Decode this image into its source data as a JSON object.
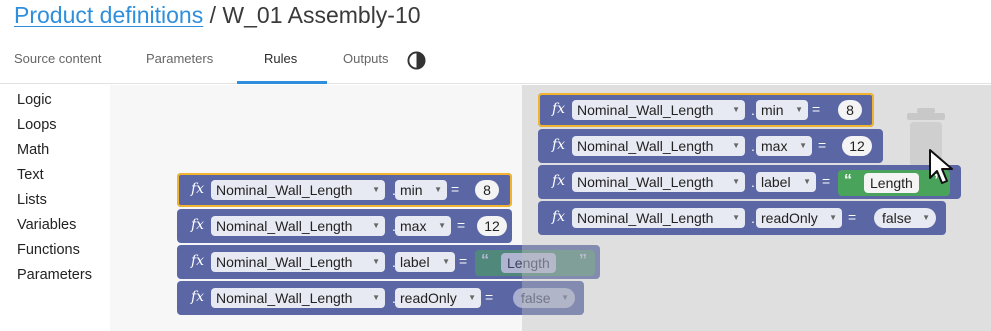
{
  "breadcrumb": {
    "link": "Product definitions",
    "separator": " / ",
    "current": "W_01 Assembly-10"
  },
  "tabs": [
    {
      "label": "Source content",
      "active": false
    },
    {
      "label": "Parameters",
      "active": false
    },
    {
      "label": "Rules",
      "active": true
    },
    {
      "label": "Outputs",
      "active": false
    }
  ],
  "icons": {
    "theme_toggle": "contrast-icon",
    "trash": "trash-can-icon",
    "cursor": "mouse-pointer-icon"
  },
  "colors": {
    "accent": "#2f8fdc",
    "block": "#5b67a5",
    "selected_outline": "#f2b42f",
    "string_block": "#4aa35b"
  },
  "toolbox": {
    "categories": [
      "Logic",
      "Loops",
      "Math",
      "Text",
      "Lists",
      "Variables",
      "Functions",
      "Parameters"
    ]
  },
  "fx_symbol": "fx",
  "workspace_blocks": [
    {
      "parameter": "Nominal_Wall_Length",
      "property": "min",
      "operator": "=",
      "value": "8",
      "value_type": "number"
    },
    {
      "parameter": "Nominal_Wall_Length",
      "property": "max",
      "operator": "=",
      "value": "12",
      "value_type": "number"
    },
    {
      "parameter": "Nominal_Wall_Length",
      "property": "label",
      "operator": "=",
      "value": "Length",
      "value_type": "string"
    },
    {
      "parameter": "Nominal_Wall_Length",
      "property": "readOnly",
      "operator": "=",
      "value": "false",
      "value_type": "boolean"
    }
  ],
  "dragged_blocks": [
    {
      "parameter": "Nominal_Wall_Length",
      "property": "min",
      "operator": "=",
      "value": "8",
      "value_type": "number"
    },
    {
      "parameter": "Nominal_Wall_Length",
      "property": "max",
      "operator": "=",
      "value": "12",
      "value_type": "number"
    },
    {
      "parameter": "Nominal_Wall_Length",
      "property": "label",
      "operator": "=",
      "value": "Length",
      "value_type": "string"
    },
    {
      "parameter": "Nominal_Wall_Length",
      "property": "readOnly",
      "operator": "=",
      "value": "false",
      "value_type": "boolean"
    }
  ]
}
